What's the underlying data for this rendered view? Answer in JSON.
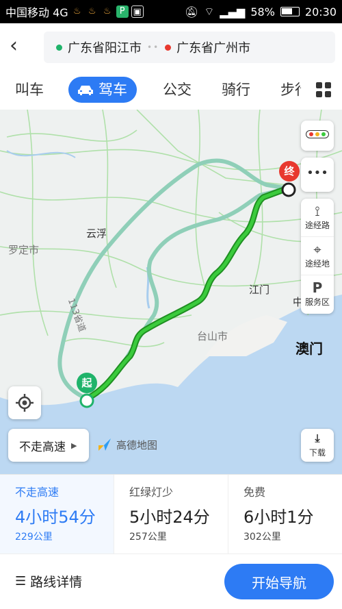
{
  "status_bar": {
    "carrier": "中国移动 4G",
    "battery": "58%",
    "time": "20:30"
  },
  "search": {
    "origin": "广东省阳江市",
    "destination": "广东省广州市",
    "origin_color": "#1fb36a",
    "destination_color": "#e8382e"
  },
  "tabs": [
    {
      "label": "叫车"
    },
    {
      "label": "驾车"
    },
    {
      "label": "公交"
    },
    {
      "label": "骑行"
    },
    {
      "label": "步行"
    }
  ],
  "map": {
    "side_tools": [
      {
        "label": "途经路"
      },
      {
        "label": "途经地"
      },
      {
        "label": "服务区"
      }
    ],
    "cities": {
      "yunfu": "云浮",
      "luoding": "罗定市",
      "jiangmen": "江门",
      "zhong": "中",
      "taishan": "台山市",
      "macau": "澳门"
    },
    "road_label": "113省道",
    "start_marker": "起",
    "end_marker": "终",
    "no_highway": "不走高速",
    "brand": "高德地图",
    "download": "下载"
  },
  "routes": [
    {
      "tag": "不走高速",
      "time": "4小时54分",
      "distance": "229公里",
      "selected": true
    },
    {
      "tag": "红绿灯少",
      "time": "5小时24分",
      "distance": "257公里",
      "selected": false
    },
    {
      "tag": "免费",
      "time": "6小时1分",
      "distance": "302公里",
      "selected": false
    }
  ],
  "footer": {
    "details": "路线详情",
    "start": "开始导航"
  },
  "colors": {
    "accent": "#2d7bf4",
    "route_active": "#22a82a",
    "route_alt": "#8fcfb8"
  }
}
